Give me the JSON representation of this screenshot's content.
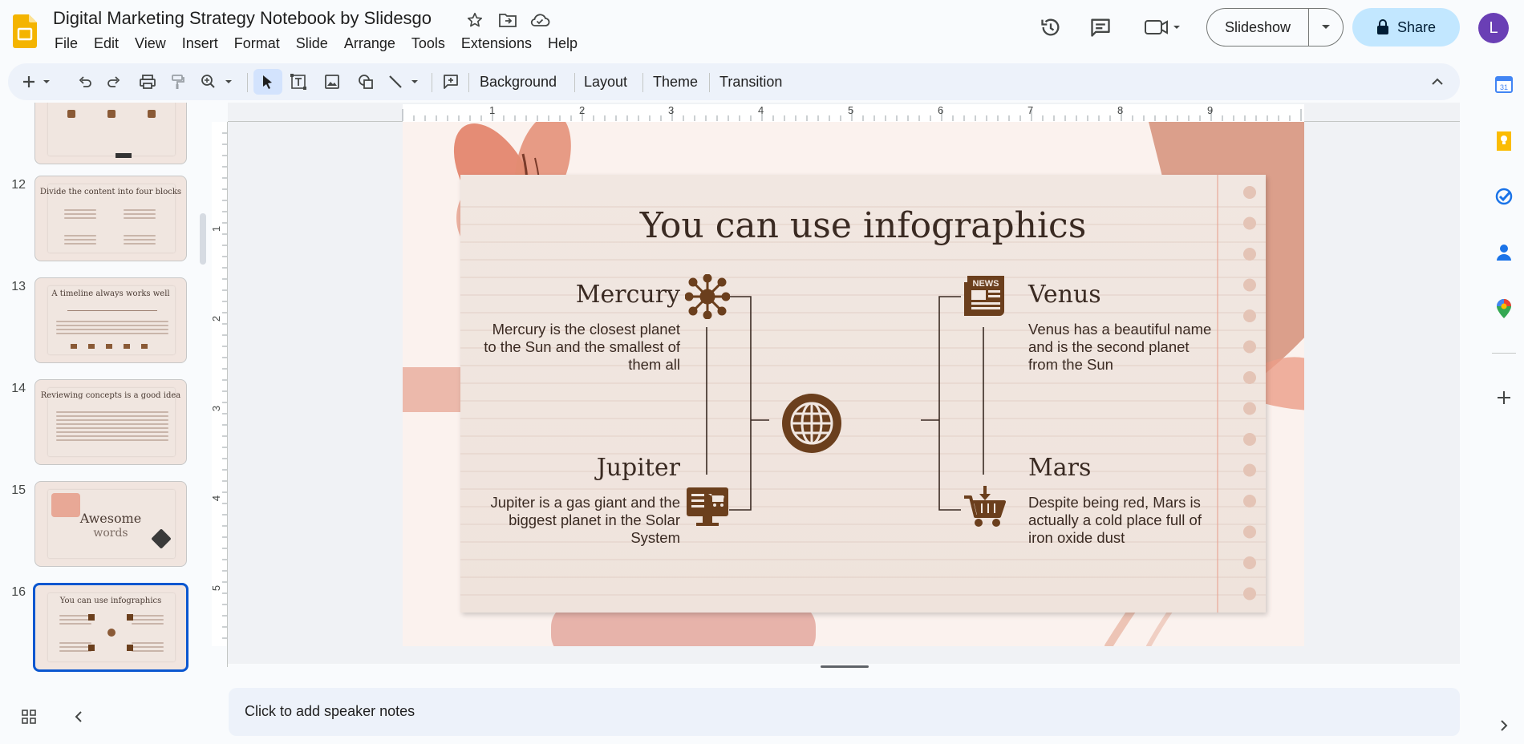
{
  "app": {
    "doc_title": "Digital Marketing Strategy Notebook by Slidesgo",
    "menu": [
      "File",
      "Edit",
      "View",
      "Insert",
      "Format",
      "Slide",
      "Arrange",
      "Tools",
      "Extensions",
      "Help"
    ],
    "slideshow_label": "Slideshow",
    "share_label": "Share",
    "avatar_letter": "L",
    "brand_color": "#f4b400",
    "accent_color": "#0b57d0"
  },
  "toolbar": {
    "background_label": "Background",
    "layout_label": "Layout",
    "theme_label": "Theme",
    "transition_label": "Transition"
  },
  "ruler": {
    "h_labels": [
      "1",
      "2",
      "3",
      "4",
      "5",
      "6",
      "7",
      "8",
      "9"
    ],
    "v_labels": [
      "1",
      "2",
      "3",
      "4",
      "5"
    ]
  },
  "filmstrip": {
    "slides": [
      {
        "num": "12",
        "title": "Divide the content into four blocks"
      },
      {
        "num": "13",
        "title": "A timeline always works well"
      },
      {
        "num": "14",
        "title": "Reviewing concepts is a good idea"
      },
      {
        "num": "15",
        "title": "Awesome",
        "subtitle": "words"
      },
      {
        "num": "16",
        "title": "You can use infographics",
        "selected": true
      }
    ]
  },
  "slide": {
    "title": "You can use infographics",
    "blocks": {
      "mercury": {
        "name": "Mercury",
        "desc": "Mercury is the closest planet to the Sun and the smallest of them all",
        "icon": "network-icon"
      },
      "venus": {
        "name": "Venus",
        "desc": "Venus has a beautiful name and is the second planet from the Sun",
        "icon": "news-icon"
      },
      "jupiter": {
        "name": "Jupiter",
        "desc": "Jupiter is a gas giant and the biggest planet in the Solar System",
        "icon": "online-shop-icon"
      },
      "mars": {
        "name": "Mars",
        "desc": "Despite being red, Mars is actually a cold place full of iron oxide dust",
        "icon": "cart-icon"
      }
    },
    "center_icon": "globe-icon",
    "icon_color": "#6b3f1d",
    "news_label": "NEWS"
  },
  "notes": {
    "placeholder": "Click to add speaker notes"
  }
}
